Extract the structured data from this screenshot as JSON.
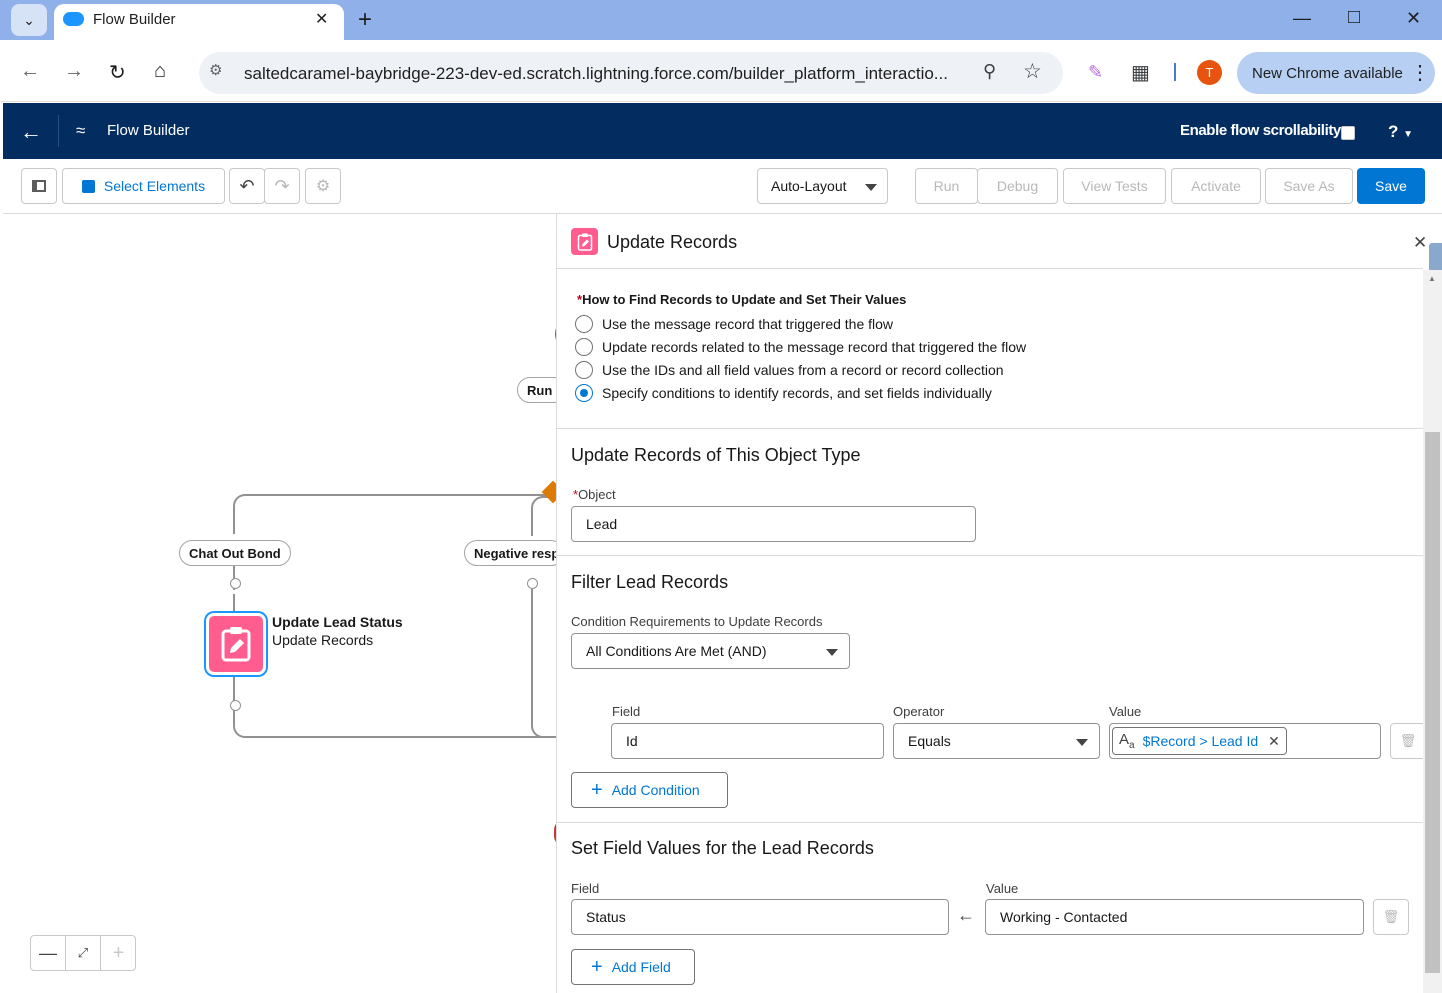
{
  "browser": {
    "tab_title": "Flow Builder",
    "url": "saltedcaramel-baybridge-223-dev-ed.scratch.lightning.force.com/builder_platform_interactio...",
    "profile_initial": "T",
    "update_label": "New Chrome available"
  },
  "header": {
    "app_title": "Flow Builder",
    "scroll_label": "Enable flow scrollability",
    "help_label": "?"
  },
  "toolbar": {
    "select_elements": "Select Elements",
    "layout": "Auto-Layout",
    "run": "Run",
    "debug": "Debug",
    "view_tests": "View Tests",
    "activate": "Activate",
    "save_as": "Save As",
    "save": "Save"
  },
  "canvas": {
    "run_pill": "Run",
    "branch_left": "Chat Out Bond",
    "branch_right": "Negative resp",
    "node_title": "Update Lead Status",
    "node_subtitle": "Update Records"
  },
  "panel": {
    "title": "Update Records",
    "how_label": "How to Find Records to Update and Set Their Values",
    "options": [
      {
        "label": "Use the message record that triggered the flow",
        "selected": false
      },
      {
        "label": "Update records related to the message record that triggered the flow",
        "selected": false
      },
      {
        "label": "Use the IDs and all field values from a record or record collection",
        "selected": false
      },
      {
        "label": "Specify conditions to identify records, and set fields individually",
        "selected": true
      }
    ],
    "object_section": "Update Records of This Object Type",
    "object_label": "Object",
    "object_value": "Lead",
    "filter_section": "Filter Lead Records",
    "condition_req_label": "Condition Requirements to Update Records",
    "condition_req_value": "All Conditions Are Met (AND)",
    "field_label": "Field",
    "operator_label": "Operator",
    "value_label": "Value",
    "cond_field": "Id",
    "cond_operator": "Equals",
    "cond_value": "$Record > Lead Id",
    "add_condition": "Add Condition",
    "set_section": "Set Field Values for the Lead Records",
    "set_field_label": "Field",
    "set_value_label": "Value",
    "set_field": "Status",
    "set_value": "Working - Contacted",
    "add_field": "Add Field"
  }
}
